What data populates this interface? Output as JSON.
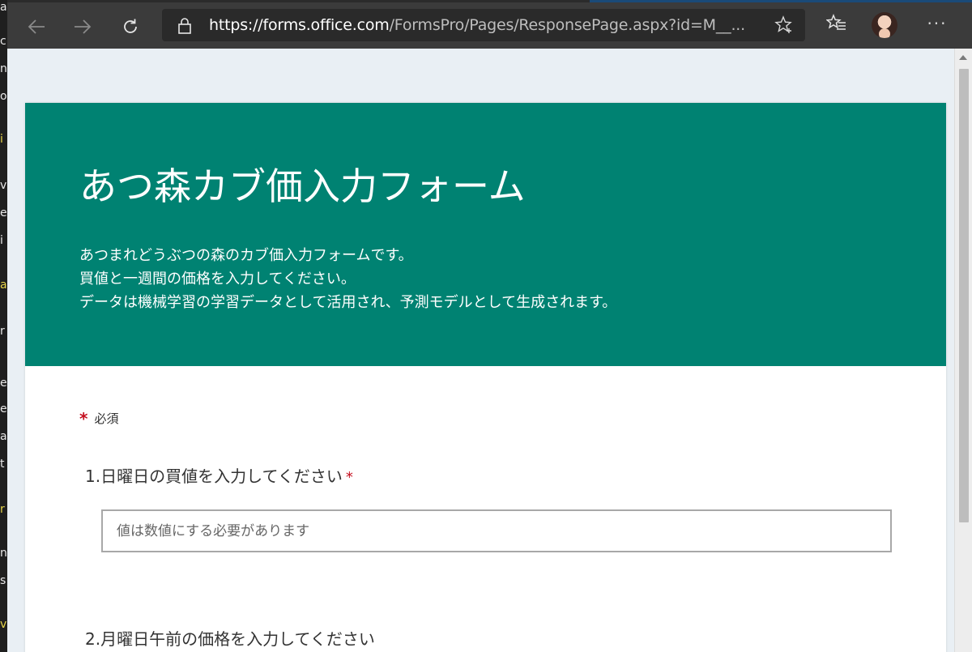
{
  "browser": {
    "url_host": "https://forms.office.com",
    "url_path": "/FormsPro/Pages/ResponsePage.aspx?id=M__..."
  },
  "form": {
    "title": "あつ森カブ価入力フォーム",
    "description": [
      "あつまれどうぶつの森のカブ価入力フォームです。",
      "買値と一週間の価格を入力してください。",
      "データは機械学習の学習データとして活用され、予測モデルとして生成されます。"
    ],
    "required_marker": "*",
    "required_note": "必須",
    "questions": [
      {
        "number": "1.",
        "label": "日曜日の買値を入力してください",
        "required": "*",
        "placeholder": "値は数値にする必要があります"
      },
      {
        "number": "2.",
        "label": "月曜日午前の価格を入力してください"
      }
    ]
  },
  "colors": {
    "header": "#008272",
    "required": "#c50f1f",
    "page_bg": "#e9eff4"
  },
  "icons": [
    "back-arrow-icon",
    "forward-arrow-icon",
    "refresh-icon",
    "lock-icon",
    "star-icon",
    "favorites-icon",
    "more-icon"
  ]
}
